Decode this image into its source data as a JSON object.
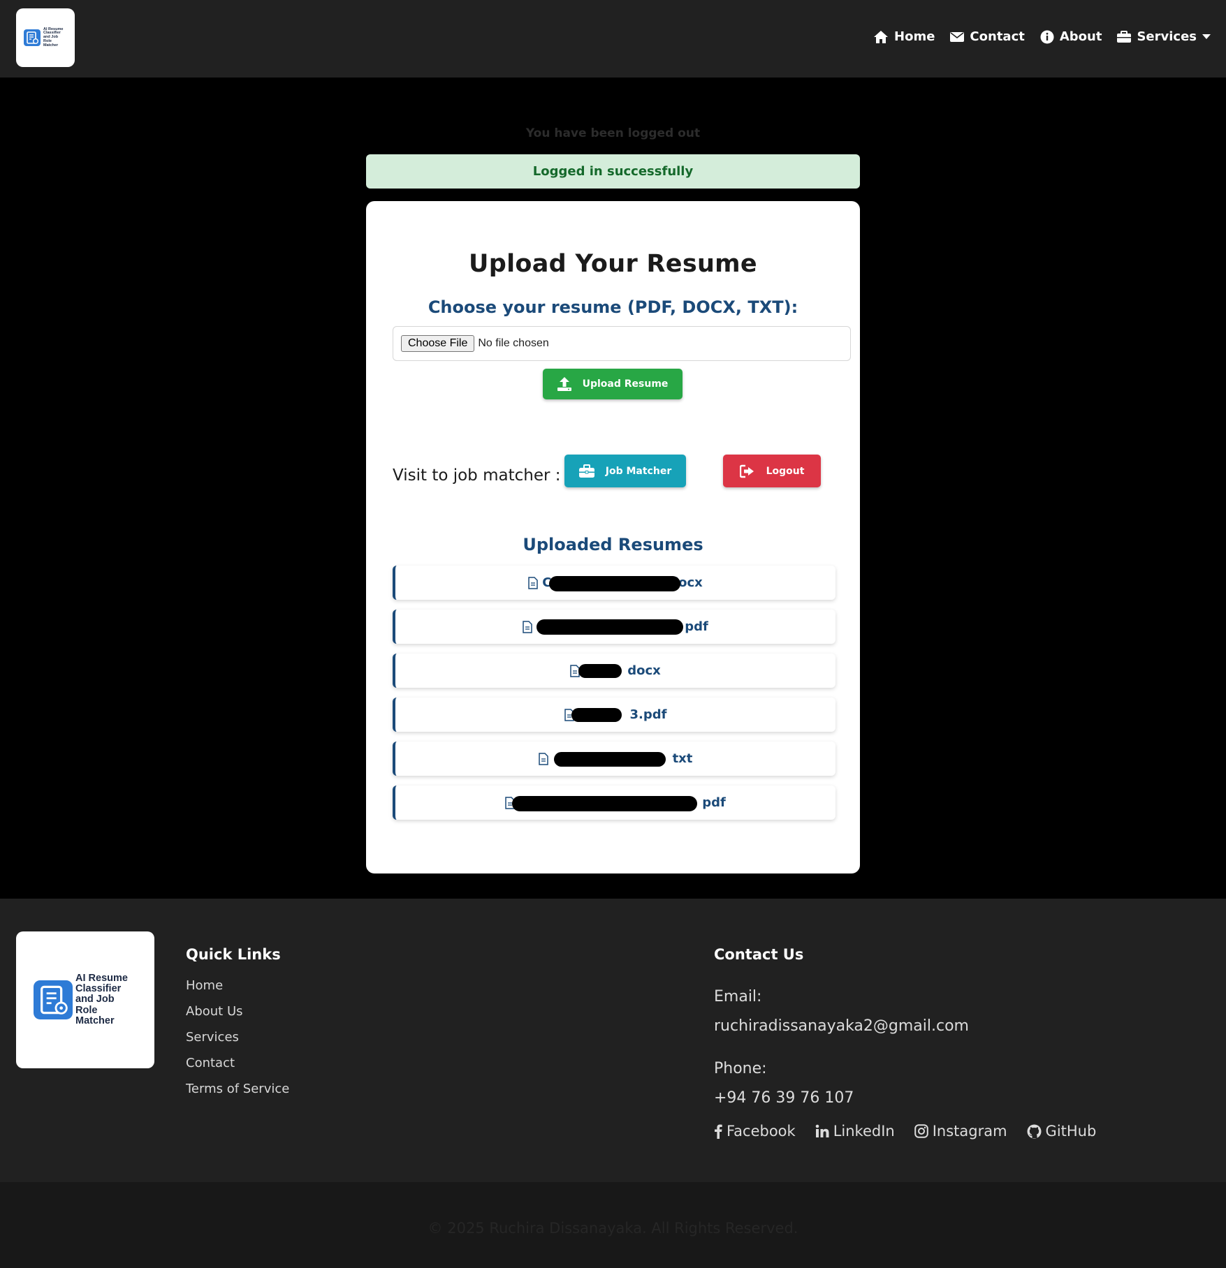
{
  "brand": {
    "logo_text": "AI Resume Classifier and Job Role Matcher"
  },
  "nav": {
    "home": "Home",
    "contact": "Contact",
    "about": "About",
    "services": "Services"
  },
  "flash": {
    "logged_out": "You have been logged out",
    "logged_in": "Logged in successfully"
  },
  "upload": {
    "title": "Upload Your Resume",
    "choose_label": "Choose your resume (PDF, DOCX, TXT):",
    "file_button": "Choose File",
    "file_status": "No file chosen",
    "upload_button": "Upload Resume"
  },
  "actions": {
    "visit_label": "Visit to job matcher :",
    "job_matcher": "Job Matcher",
    "logout": "Logout"
  },
  "uploaded": {
    "title": "Uploaded Resumes",
    "files": [
      {
        "prefix": "C",
        "suffix": ".docx"
      },
      {
        "prefix": "",
        "suffix": "pdf"
      },
      {
        "prefix": "",
        "suffix": "docx"
      },
      {
        "prefix": "",
        "suffix": "3.pdf"
      },
      {
        "prefix": "",
        "suffix": "txt"
      },
      {
        "prefix": "",
        "suffix": "pdf"
      }
    ]
  },
  "footer": {
    "quick_links_title": "Quick Links",
    "quick_links": [
      "Home",
      "About Us",
      "Services",
      "Contact",
      "Terms of Service"
    ],
    "contact_title": "Contact Us",
    "email_label": "Email:",
    "email": "ruchiradissanayaka2@gmail.com",
    "phone_label": "Phone:",
    "phone": "+94 76 39 76 107",
    "socials": [
      "Facebook",
      "LinkedIn",
      "Instagram",
      "GitHub"
    ],
    "copyright": "© 2025 Ruchira Dissanayaka. All Rights Reserved."
  },
  "colors": {
    "navbar_bg": "#212121",
    "success_bg": "#d4edda",
    "primary_text": "#1b4a79",
    "upload_btn": "#28a745",
    "job_btn": "#17a2b8",
    "logout_btn": "#dc3545",
    "logo_blue": "#2e7bd6"
  }
}
